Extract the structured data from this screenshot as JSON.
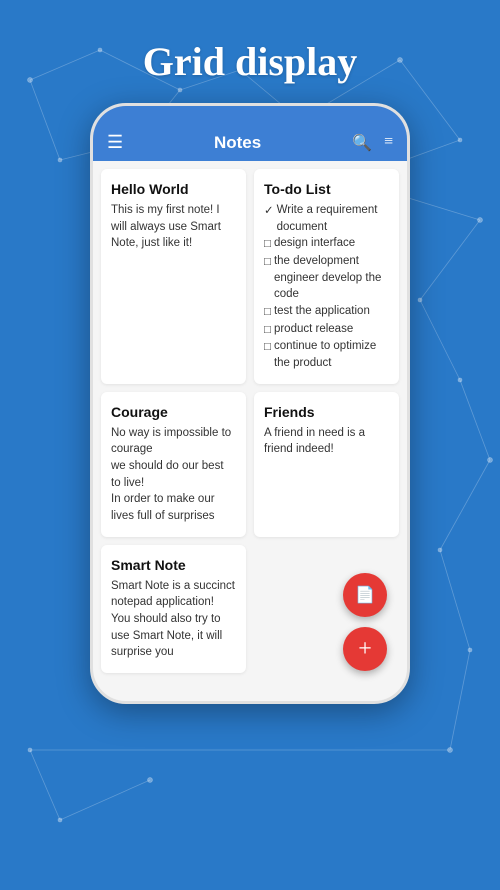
{
  "page": {
    "title": "Grid display",
    "background_color": "#2979c8"
  },
  "app_bar": {
    "menu_icon": "☰",
    "title": "Notes",
    "search_icon": "🔍",
    "filter_icon": "⚌"
  },
  "notes": [
    {
      "id": "hello-world",
      "title": "Hello World",
      "body": "This is my first note! I will always use Smart Note, just like it!",
      "type": "text"
    },
    {
      "id": "todo-list",
      "title": "To-do List",
      "type": "todo",
      "items": [
        {
          "checked": true,
          "text": "Write a requirement document"
        },
        {
          "checked": false,
          "text": "design interface"
        },
        {
          "checked": false,
          "text": "the development engineer develop the code"
        },
        {
          "checked": false,
          "text": "test the application"
        },
        {
          "checked": false,
          "text": "product release"
        },
        {
          "checked": false,
          "text": "continue to optimize the product"
        }
      ]
    },
    {
      "id": "courage",
      "title": "Courage",
      "body": "No way is impossible to courage\nwe should do our best to live!\nIn order to make our lives full of surprises",
      "type": "text"
    },
    {
      "id": "friends",
      "title": "Friends",
      "body": "A friend in need is a friend indeed!",
      "type": "text"
    },
    {
      "id": "smart-note",
      "title": "Smart Note",
      "body": "Smart Note is a succinct notepad application!\nYou should also try to use Smart Note, it will surprise you",
      "type": "text"
    }
  ],
  "fab": {
    "doc_icon": "📄",
    "add_icon": "+"
  }
}
